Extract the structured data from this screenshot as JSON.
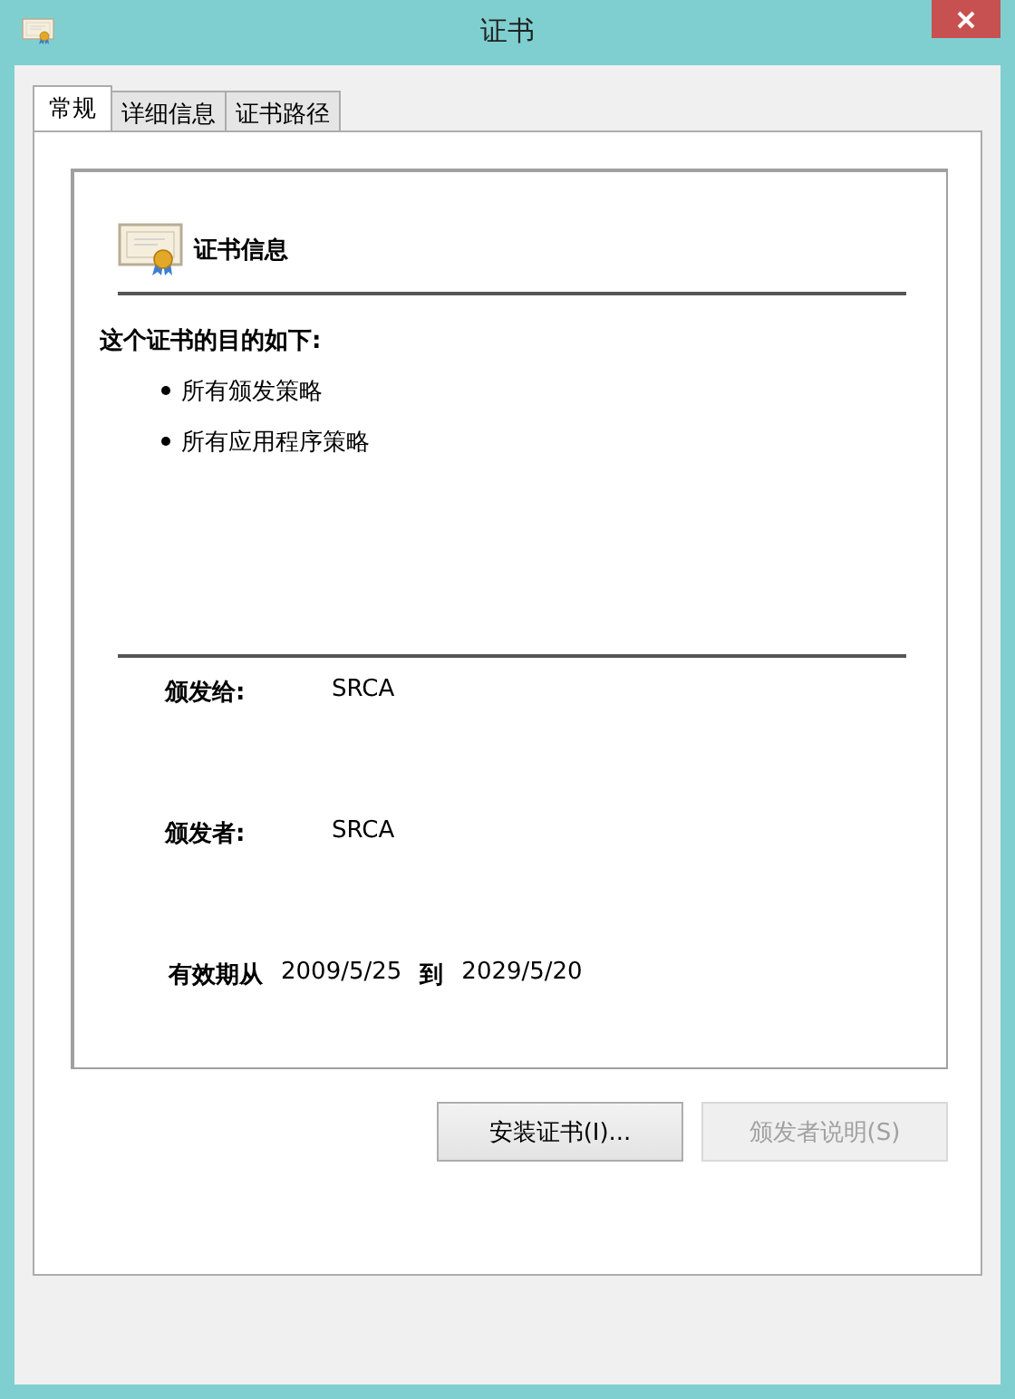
{
  "window": {
    "title": "证书"
  },
  "tabs": [
    {
      "label": "常规",
      "selected": true
    },
    {
      "label": "详细信息",
      "selected": false
    },
    {
      "label": "证书路径",
      "selected": false
    }
  ],
  "info": {
    "title": "证书信息",
    "purpose_heading": "这个证书的目的如下:",
    "purposes": [
      "所有颁发策略",
      "所有应用程序策略"
    ]
  },
  "details": [
    {
      "label": "颁发给:",
      "value": "SRCA"
    },
    {
      "label": "颁发者:",
      "value": "SRCA"
    }
  ],
  "validity": {
    "label": "有效期从",
    "from": "2009/5/25",
    "separator": "到",
    "to": "2029/5/20"
  },
  "buttons": [
    {
      "label": "安装证书(I)...",
      "disabled": false
    },
    {
      "label": "颁发者说明(S)",
      "disabled": true
    }
  ]
}
